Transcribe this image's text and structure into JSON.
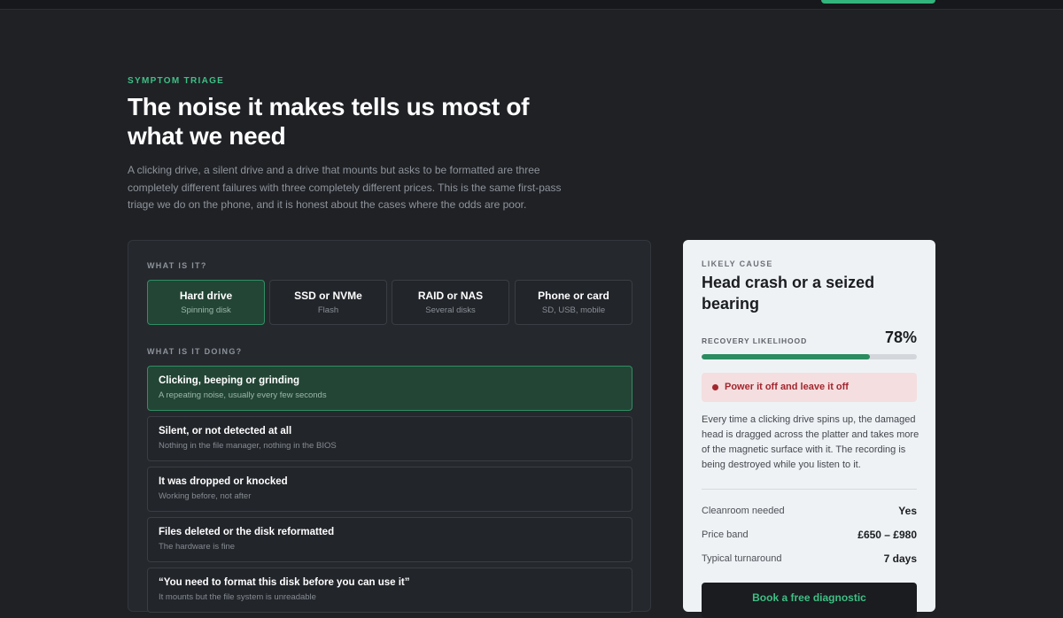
{
  "triage": {
    "eyebrow": "SYMPTOM TRIAGE",
    "title": "The noise it makes tells us most of what we need",
    "lede": "A clicking drive, a silent drive and a drive that mounts but asks to be formatted are three completely different failures with three completely different prices. This is the same first-pass triage we do on the phone, and it is honest about the cases where the odds are poor."
  },
  "selector": {
    "device_label": "WHAT IS IT?",
    "devices": [
      {
        "title": "Hard drive",
        "sub": "Spinning disk",
        "selected": true
      },
      {
        "title": "SSD or NVMe",
        "sub": "Flash",
        "selected": false
      },
      {
        "title": "RAID or NAS",
        "sub": "Several disks",
        "selected": false
      },
      {
        "title": "Phone or card",
        "sub": "SD, USB, mobile",
        "selected": false
      }
    ],
    "symptom_label": "WHAT IS IT DOING?",
    "symptoms": [
      {
        "title": "Clicking, beeping or grinding",
        "sub": "A repeating noise, usually every few seconds",
        "selected": true
      },
      {
        "title": "Silent, or not detected at all",
        "sub": "Nothing in the file manager, nothing in the BIOS",
        "selected": false
      },
      {
        "title": "It was dropped or knocked",
        "sub": "Working before, not after",
        "selected": false
      },
      {
        "title": "Files deleted or the disk reformatted",
        "sub": "The hardware is fine",
        "selected": false
      },
      {
        "title": "“You need to format this disk before you can use it”",
        "sub": "It mounts but the file system is unreadable",
        "selected": false
      }
    ]
  },
  "result": {
    "label": "LIKELY CAUSE",
    "cause": "Head crash or a seized bearing",
    "recovery_label": "RECOVERY LIKELIHOOD",
    "recovery_pct": "78%",
    "recovery_fraction": 0.78,
    "alert": "Power it off and leave it off",
    "description": "Every time a clicking drive spins up, the damaged head is dragged across the platter and takes more of the magnetic surface with it. The recording is being destroyed while you listen to it.",
    "facts": [
      {
        "key": "Cleanroom needed",
        "value": "Yes"
      },
      {
        "key": "Price band",
        "value": "£650 – £980"
      },
      {
        "key": "Typical turnaround",
        "value": "7 days"
      }
    ],
    "cta": "Book a free diagnostic"
  },
  "colors": {
    "accent": "#3fbf85",
    "selected_bg": "#234536",
    "alert": "#a3262f"
  }
}
